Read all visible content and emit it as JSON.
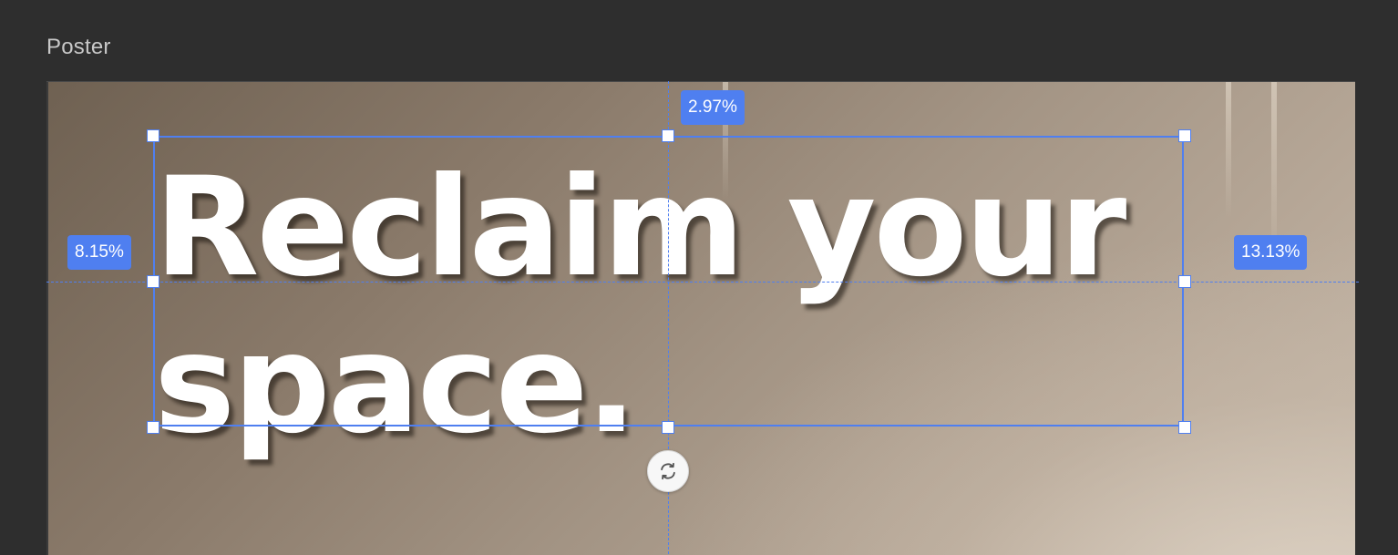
{
  "panel": {
    "title": "Poster"
  },
  "poster": {
    "headline_line1": "Reclaim your",
    "headline_line2": "space."
  },
  "selection": {
    "margin_top": "2.97%",
    "margin_left": "8.15%",
    "margin_right": "13.13%",
    "rotate_icon": "rotate-icon"
  },
  "colors": {
    "accent": "#4f7ff0",
    "panel_background": "#2e2e2e",
    "headline_text": "#ffffff"
  }
}
